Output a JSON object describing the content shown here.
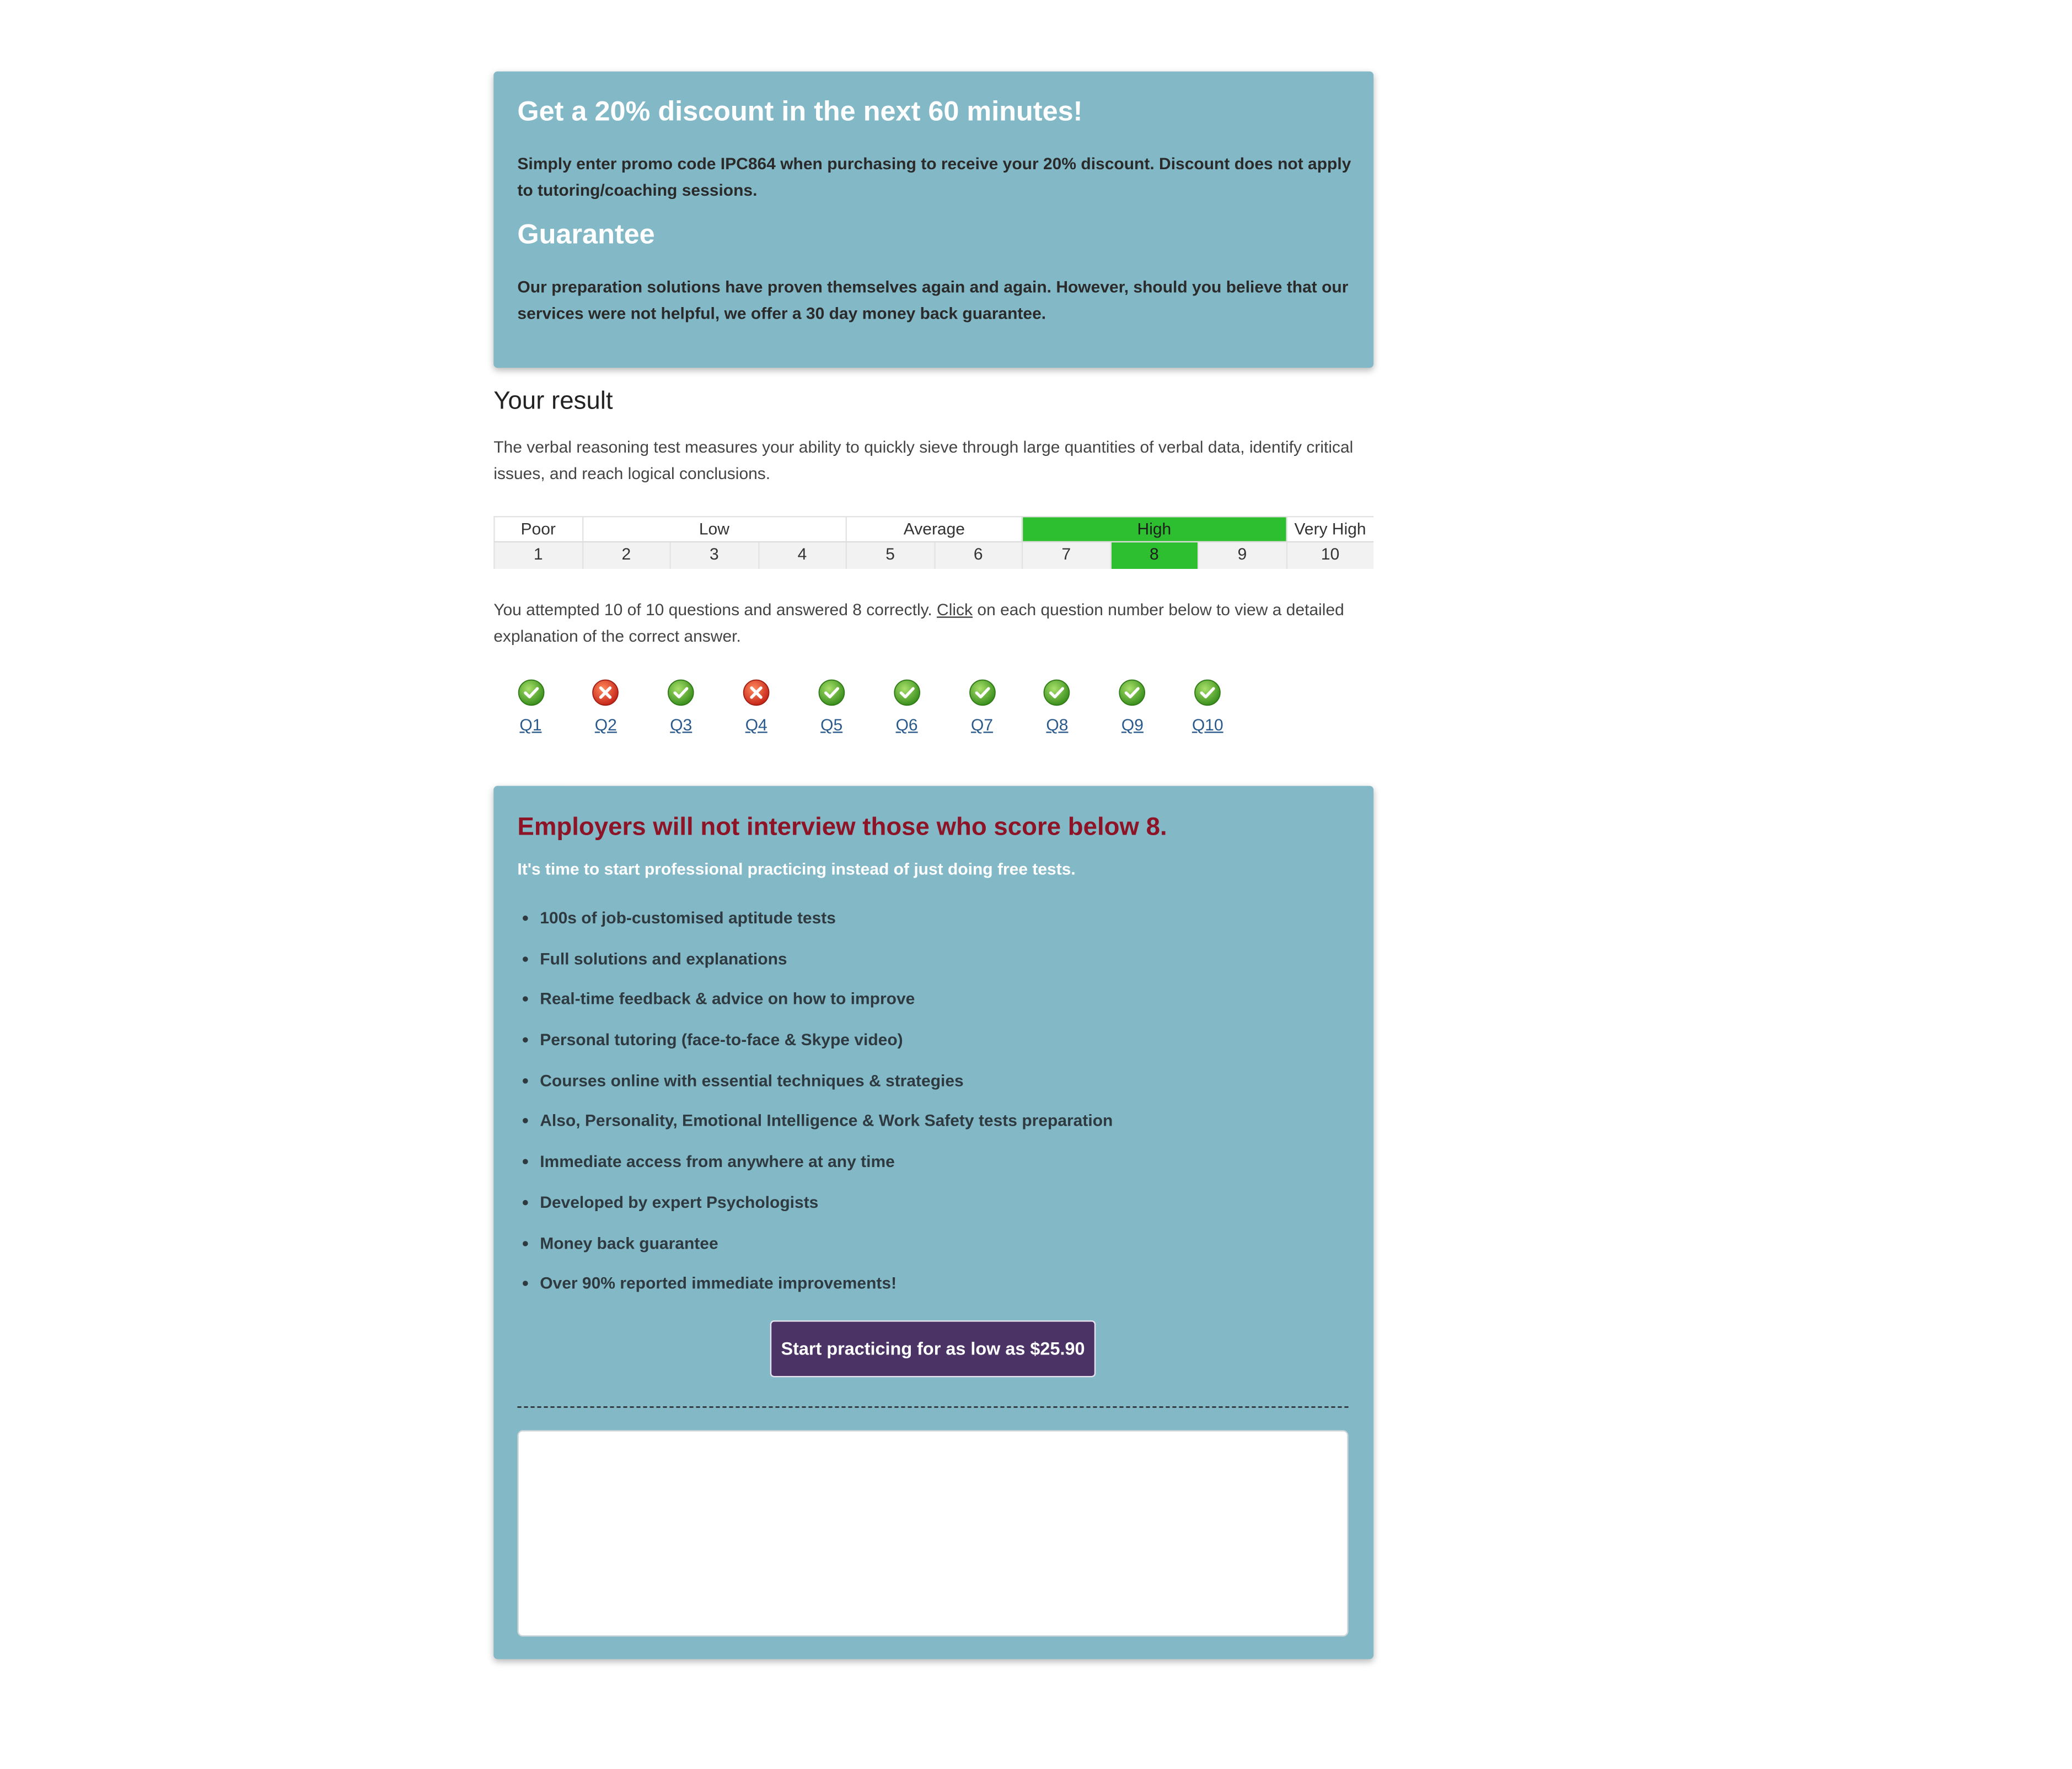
{
  "promo": {
    "title": "Get a 20% discount in the next 60 minutes!",
    "text": "Simply enter promo code IPC864 when purchasing to receive your 20% discount. Discount does not apply to tutoring/coaching sessions.",
    "guarantee_title": "Guarantee",
    "guarantee_text": "Our preparation solutions have proven themselves again and again. However, should you believe that our services were not helpful, we offer a 30 day money back guarantee."
  },
  "result": {
    "title": "Your result",
    "description": "The verbal reasoning test measures your ability to quickly sieve through large quantities of verbal data, identify critical issues, and reach logical conclusions.",
    "bands": [
      "Poor",
      "Low",
      "Average",
      "High",
      "Very High"
    ],
    "scale_numbers": [
      "1",
      "2",
      "3",
      "4",
      "5",
      "6",
      "7",
      "8",
      "9",
      "10"
    ],
    "highlighted_band": "High",
    "score": "8",
    "highlight_color": "#2dbf2f",
    "attempt_text_before": "You attempted 10 of 10 questions and answered 8 correctly. ",
    "attempt_link": "Click",
    "attempt_text_after": " on each question number below to view a detailed explanation of the correct answer."
  },
  "questions": [
    {
      "label": "Q1",
      "status": "correct",
      "icon": "check-icon"
    },
    {
      "label": "Q2",
      "status": "incorrect",
      "icon": "cross-icon"
    },
    {
      "label": "Q3",
      "status": "correct",
      "icon": "check-icon"
    },
    {
      "label": "Q4",
      "status": "incorrect",
      "icon": "cross-icon"
    },
    {
      "label": "Q5",
      "status": "correct",
      "icon": "check-icon"
    },
    {
      "label": "Q6",
      "status": "correct",
      "icon": "check-icon"
    },
    {
      "label": "Q7",
      "status": "correct",
      "icon": "check-icon"
    },
    {
      "label": "Q8",
      "status": "correct",
      "icon": "check-icon"
    },
    {
      "label": "Q9",
      "status": "correct",
      "icon": "check-icon"
    },
    {
      "label": "Q10",
      "status": "correct",
      "icon": "check-icon"
    }
  ],
  "offer": {
    "headline": "Employers will not interview those who score below 8.",
    "subline": "It's time to start professional practicing instead of just doing free tests.",
    "features": [
      "100s of job-customised aptitude tests",
      "Full solutions and explanations",
      "Real-time feedback & advice on how to improve",
      "Personal tutoring (face-to-face & Skype video)",
      "Courses online with essential techniques & strategies",
      "Also, Personality, Emotional Intelligence & Work Safety tests preparation",
      "Immediate access from anywhere at any time",
      "Developed by expert Psychologists",
      "Money back guarantee",
      "Over 90% reported immediate improvements!"
    ],
    "cta_label": "Start practicing for as low as $25.90"
  },
  "colors": {
    "panel": "#83b9c7",
    "headline": "#8c1426",
    "cta": "#4b3465",
    "correct": "#3fa52a",
    "incorrect": "#d8381d"
  }
}
